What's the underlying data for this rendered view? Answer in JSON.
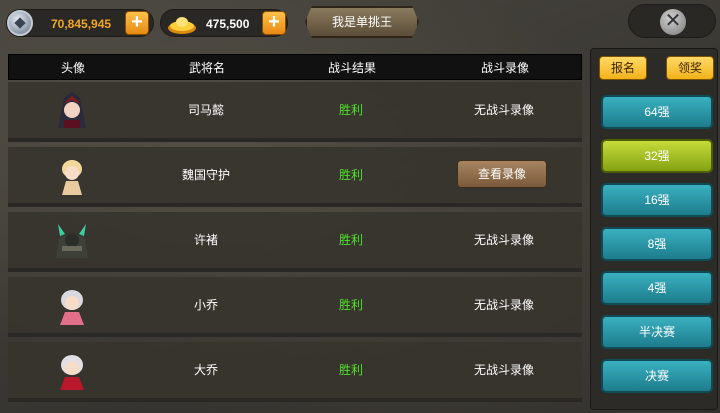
{
  "currency": {
    "silver": {
      "value": "70,845,945",
      "icon": "silver-coin-icon",
      "color": "#f2a624"
    },
    "gold": {
      "value": "475,500",
      "icon": "gold-ingot-icon",
      "color": "#ffffff"
    }
  },
  "title": "我是单挑王",
  "table": {
    "headers": [
      "头像",
      "武将名",
      "战斗结果",
      "战斗录像"
    ],
    "rows": [
      {
        "name": "司马懿",
        "result": "胜利",
        "replay": "无战斗录像",
        "has_replay": false,
        "avatar": "simayi-avatar"
      },
      {
        "name": "魏国守护",
        "result": "胜利",
        "replay": "查看录像",
        "has_replay": true,
        "avatar": "weiguo-guard-avatar"
      },
      {
        "name": "许褚",
        "result": "胜利",
        "replay": "无战斗录像",
        "has_replay": false,
        "avatar": "xuchu-avatar"
      },
      {
        "name": "小乔",
        "result": "胜利",
        "replay": "无战斗录像",
        "has_replay": false,
        "avatar": "xiaoqiao-avatar"
      },
      {
        "name": "大乔",
        "result": "胜利",
        "replay": "无战斗录像",
        "has_replay": false,
        "avatar": "daqiao-avatar"
      }
    ]
  },
  "tabs": {
    "signup": "报名",
    "reward": "领奖"
  },
  "stages": [
    {
      "label": "64强",
      "active": false
    },
    {
      "label": "32强",
      "active": true
    },
    {
      "label": "16强",
      "active": false
    },
    {
      "label": "8强",
      "active": false
    },
    {
      "label": "4强",
      "active": false
    },
    {
      "label": "半决赛",
      "active": false
    },
    {
      "label": "决赛",
      "active": false
    }
  ],
  "colors": {
    "win": "#4ee32a",
    "stage": "#2a97a7",
    "stage_active": "#a6c21f",
    "tab": "#f5bd2a"
  }
}
